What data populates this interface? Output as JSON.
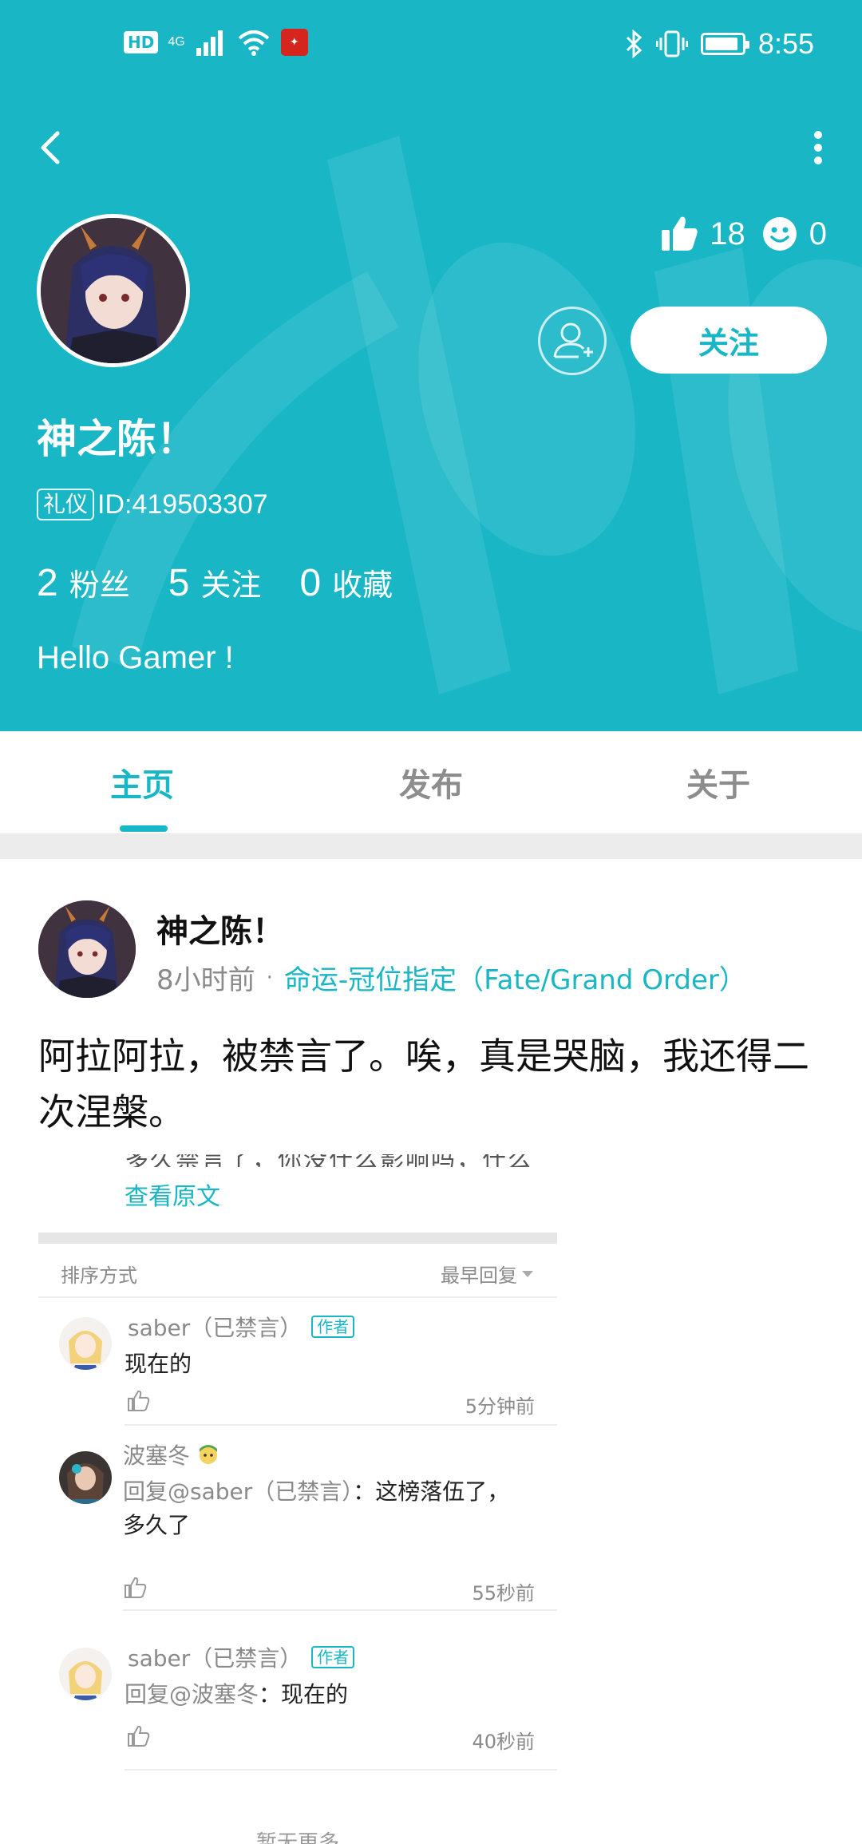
{
  "status_bar": {
    "hd": "HD",
    "network": "4G",
    "time": "8:55",
    "battery_level": 0.8
  },
  "profile": {
    "nickname": "神之陈！",
    "role_tag": "礼仪",
    "id_label": "ID:419503307",
    "likes": "18",
    "smiles": "0",
    "follow_label": "关注",
    "fans_count": "2",
    "fans_label": "粉丝",
    "following_count": "5",
    "following_label": "关注",
    "favorites_count": "0",
    "favorites_label": "收藏",
    "bio": "Hello Gamer !"
  },
  "tabs": [
    {
      "label": "主页",
      "active": true
    },
    {
      "label": "发布",
      "active": false
    },
    {
      "label": "关于",
      "active": false
    }
  ],
  "post": {
    "author": "神之陈！",
    "time": "8小时前",
    "separator": "·",
    "game": "命运-冠位指定（Fate/Grand Order）",
    "text": "阿拉阿拉，被禁言了。唉，真是哭脑，我还得二次涅槃。"
  },
  "embed": {
    "cut_text": "多久禁言了，你没什么影响吗，什么",
    "view_original": "查看原文",
    "sort_label": "排序方式",
    "sort_value": "最早回复",
    "replies": [
      {
        "name": "saber（已禁言）",
        "tag": "作者",
        "mention": "",
        "text": "现在的",
        "time": "5分钟前"
      },
      {
        "name": "波塞冬",
        "tag": "",
        "mention": "回复@saber（已禁言）",
        "text": "：这榜落伍了，多久了",
        "time": "55秒前"
      },
      {
        "name": "saber（已禁言）",
        "tag": "作者",
        "mention": "回复@波塞冬",
        "text": "：现在的",
        "time": "40秒前"
      }
    ],
    "more": "暂无更多"
  },
  "colors": {
    "accent": "#19b6c6",
    "divider": "#ececec"
  }
}
